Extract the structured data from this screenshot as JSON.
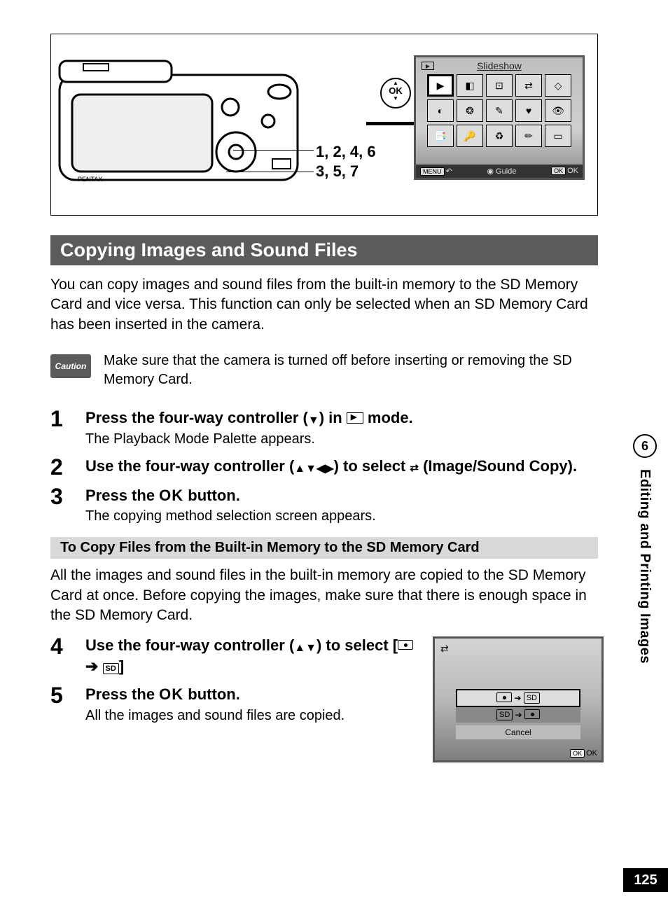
{
  "chapter": {
    "number": "6",
    "title": "Editing and Printing Images"
  },
  "page_number": "125",
  "figure": {
    "label_line1": "1, 2, 4, 6",
    "label_line2": "3, 5, 7",
    "ok_label": "OK",
    "camera_brand": "PENTAX"
  },
  "lcd1": {
    "title": "Slideshow",
    "footer_menu": "MENU",
    "footer_guide": "Guide",
    "footer_ok_badge": "OK",
    "footer_ok": "OK",
    "icons": [
      "▶",
      "◧",
      "⊡",
      "⇄",
      "◇",
      "◐",
      "❂",
      "✎",
      "♥",
      "👁",
      "📑",
      "🔑",
      "♻",
      "✏",
      "▭"
    ]
  },
  "section": {
    "heading": "Copying Images and Sound Files",
    "intro": "You can copy images and sound files from the built-in memory to the SD Memory Card and vice versa. This function can only be selected when an SD Memory Card has been inserted in the camera."
  },
  "caution": {
    "label": "Caution",
    "text": "Make sure that the camera is turned off before inserting or removing the SD Memory Card."
  },
  "steps": [
    {
      "n": "1",
      "title_pre": "Press the four-way controller (",
      "title_mid": "▼",
      "title_post": ") in ",
      "title_end": " mode.",
      "desc": "The Playback Mode Palette appears."
    },
    {
      "n": "2",
      "title_pre": "Use the four-way controller (",
      "title_mid": "▲▼◀▶",
      "title_post": ") to select ",
      "title_end": " (Image/Sound Copy).",
      "desc": ""
    },
    {
      "n": "3",
      "title_pre": "Press the ",
      "title_mid": "OK",
      "title_post": " button.",
      "title_end": "",
      "desc": "The copying method selection screen appears."
    }
  ],
  "subsection": {
    "bar": "To Copy Files from the Built-in Memory to the SD Memory Card",
    "intro": "All the images and sound files in the built-in memory are copied to the SD Memory Card at once. Before copying the images, make sure that there is enough space in the SD Memory Card."
  },
  "steps2": [
    {
      "n": "4",
      "title_pre": "Use the four-way controller (",
      "title_mid": "▲▼",
      "title_post": ") to select [",
      "title_end": "]",
      "desc": ""
    },
    {
      "n": "5",
      "title_pre": "Press the ",
      "title_mid": "OK",
      "title_post": " button.",
      "title_end": "",
      "desc": "All the images and sound files are copied."
    }
  ],
  "lcd2": {
    "opt_sd": "SD",
    "cancel": "Cancel",
    "ok_badge": "OK",
    "ok": "OK"
  }
}
